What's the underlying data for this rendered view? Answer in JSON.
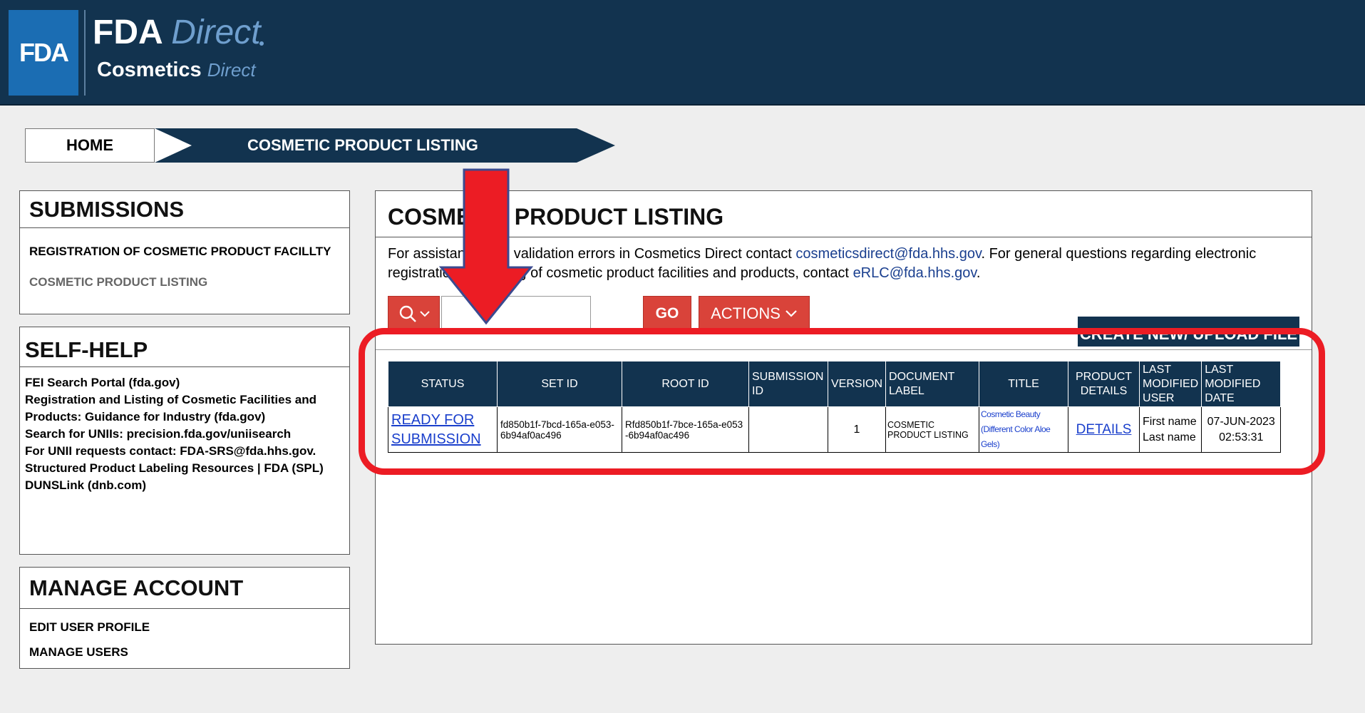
{
  "header": {
    "badge": "FDA",
    "brand_bold": "FDA ",
    "brand_italic": "Direct",
    "sub_bold": "Cosmetics ",
    "sub_italic": "Direct"
  },
  "breadcrumb": {
    "home": "HOME",
    "current": "COSMETIC PRODUCT LISTING"
  },
  "submissions": {
    "title": "SUBMISSIONS",
    "items": [
      "REGISTRATION OF COSMETIC PRODUCT FACILLTY",
      "COSMETIC PRODUCT LISTING"
    ]
  },
  "self_help": {
    "title": "SELF-HELP",
    "items": [
      "FEI Search Portal (fda.gov)",
      "Registration and Listing of Cosmetic Facilities and Products: Guidance for Industry (fda.gov)",
      "Search for UNIIs: precision.fda.gov/uniisearch",
      "For UNII requests contact:  FDA-SRS@fda.hhs.gov.",
      "Structured Product Labeling Resources | FDA (SPL)",
      "DUNSLink (dnb.com)"
    ]
  },
  "manage_account": {
    "title": "MANAGE ACCOUNT",
    "items": [
      "EDIT USER PROFILE",
      "MANAGE USERS"
    ]
  },
  "main": {
    "title": "COSMETIC PRODUCT LISTING",
    "info_1": "For assistance with validation errors in Cosmetics Direct contact ",
    "email_1": "cosmeticsdirect@fda.hhs.gov",
    "info_2": ". For general questions regarding electronic registration and listing of cosmetic product facilities and products, contact ",
    "email_2": "eRLC@fda.hhs.gov",
    "info_3": ".",
    "search_placeholder": "",
    "go_label": "GO",
    "actions_label": "ACTIONS",
    "create_label": "CREATE NEW/ UPLOAD FILE"
  },
  "table": {
    "headers": [
      "STATUS",
      "SET ID",
      "ROOT ID",
      "SUBMISSION ID",
      "VERSION",
      "DOCUMENT LABEL",
      "TITLE",
      "PRODUCT DETAILS",
      "LAST MODIFIED USER",
      "LAST MODIFIED DATE"
    ],
    "row": {
      "status": "READY FOR SUBMISSION",
      "set_id": "fd850b1f-7bcd-165a-e053-6b94af0ac496",
      "root_id": "Rfd850b1f-7bce-165a-e053-6b94af0ac496",
      "submission_id": "",
      "version": "1",
      "document_label": "COSMETIC PRODUCT LISTING",
      "title": "Cosmetic Beauty (Different Color Aloe Gels)",
      "details": "DETAILS",
      "user": "First name Last name",
      "date": "07-JUN-2023 02:53:31"
    }
  },
  "colors": {
    "navy": "#12334f",
    "fda_blue": "#1b6db3",
    "button_red": "#d9433a",
    "annotation_red": "#ec1c24",
    "link_blue": "#1a3fcc"
  },
  "icons": [
    "search-icon",
    "chevron-down-icon",
    "down-arrow-annotation"
  ]
}
